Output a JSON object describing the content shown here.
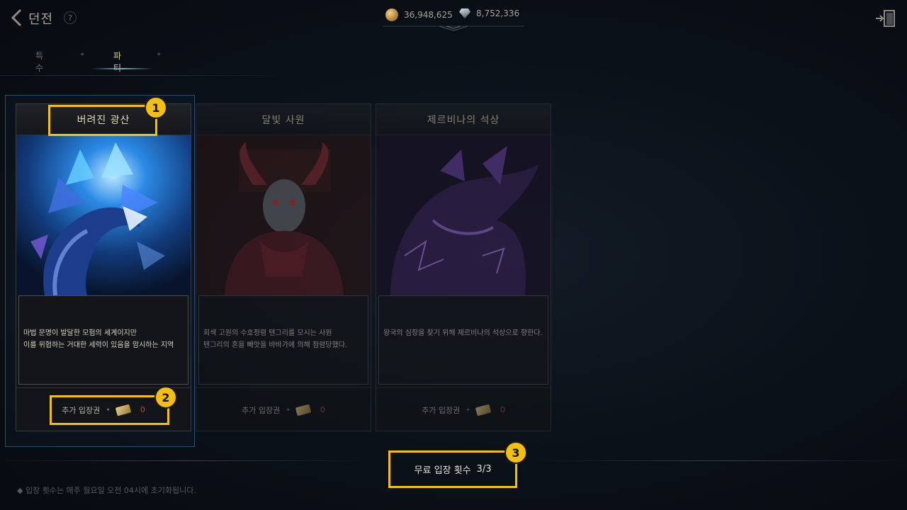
{
  "header": {
    "title": "던전",
    "help_symbol": "?",
    "gold": "36,948,625",
    "gems": "8,752,336"
  },
  "tabs": [
    {
      "label": "특수",
      "active": false
    },
    {
      "label": "파티",
      "active": true
    }
  ],
  "dungeons": [
    {
      "name": "버려진 광산",
      "desc_line1": "마법 문명이 발달한 모험의 세계이지만",
      "desc_line2": "이를 위협하는 거대한 세력이 있음을 암시하는 지역",
      "ticket_label": "추가 입장권",
      "ticket_count": "0",
      "selected": true
    },
    {
      "name": "달빛 사원",
      "desc_line1": "회색 고원의 수호정령 텐그리를 모시는 사원",
      "desc_line2": "텐그리의 혼을 빼앗을 바바가에 의해 점령당했다.",
      "ticket_label": "추가 입장권",
      "ticket_count": "0",
      "selected": false
    },
    {
      "name": "제르비나의 석상",
      "desc_line1": "왕국의 심장을 찾기 위해 제르비나의 석상으로 향한다.",
      "desc_line2": "",
      "ticket_label": "추가 입장권",
      "ticket_count": "0",
      "selected": false
    }
  ],
  "free_entry": {
    "label": "무료 입장 횟수",
    "value": "3/3"
  },
  "notice": "입장 횟수는 매주 월요일 오전 04시에 초기화됩니다.",
  "callouts": [
    "1",
    "2",
    "3"
  ],
  "colors": {
    "highlight": "#f3c010",
    "ticket_count": "#d3423a",
    "selection": "#2d4c75"
  }
}
